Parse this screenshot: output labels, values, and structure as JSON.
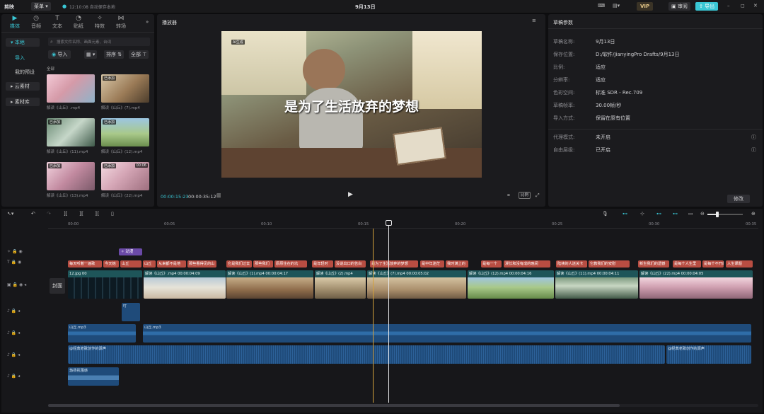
{
  "app": {
    "logo": "剪映",
    "menu": "菜单",
    "autosave": "12:10:08 自动保存本地",
    "project_title": "9月13日",
    "vip": "VIP",
    "review": "审阅",
    "export": "导出"
  },
  "media_panel": {
    "tabs": [
      {
        "label": "媒体",
        "icon": "media-icon"
      },
      {
        "label": "音频",
        "icon": "audio-icon"
      },
      {
        "label": "文本",
        "icon": "text-icon"
      },
      {
        "label": "贴纸",
        "icon": "sticker-icon"
      },
      {
        "label": "特效",
        "icon": "effects-icon"
      },
      {
        "label": "转场",
        "icon": "transition-icon"
      }
    ],
    "sidebar": [
      "本地",
      "导入",
      "我的预设",
      "云素材",
      "素材库"
    ],
    "search_placeholder": "搜索文件名称、画面元素、台词",
    "import_label": "导入",
    "sort_label": "排序",
    "filter_label": "全部",
    "section_label": "全部",
    "items": [
      {
        "name": "解读《山丘》.mp4",
        "badge": ""
      },
      {
        "name": "解读《山丘》(7).mp4",
        "badge": "已添加"
      },
      {
        "name": "解读《山丘》(11).mp4",
        "badge": "已添加"
      },
      {
        "name": "解读《山丘》(12).mp4",
        "badge": "已添加"
      },
      {
        "name": "解读《山丘》(13).mp4",
        "badge": "已添加"
      },
      {
        "name": "解读《山丘》(22).mp4",
        "badge": "已添加",
        "duration": "00:06"
      }
    ]
  },
  "player": {
    "title": "播放器",
    "overlay_tag": "AI生成",
    "subtitle": "是为了生活放弃的梦想",
    "current_time": "00:00:15:23",
    "total_time": "00:00:35:12",
    "ratio_label": "比例"
  },
  "draft": {
    "title": "草稿参数",
    "props": [
      {
        "k": "草稿名称:",
        "v": "9月13日"
      },
      {
        "k": "保存位置:",
        "v": "D:/软件/JianyingPro Drafts/9月13日"
      },
      {
        "k": "比例:",
        "v": "适应"
      },
      {
        "k": "分辨率:",
        "v": "适应"
      },
      {
        "k": "色彩空间:",
        "v": "标准 SDR - Rec.709"
      },
      {
        "k": "草稿帧率:",
        "v": "30.00帧/秒"
      },
      {
        "k": "导入方式:",
        "v": "保留在原有位置"
      }
    ],
    "props2": [
      {
        "k": "代理模式:",
        "v": "未开启"
      },
      {
        "k": "自由层级:",
        "v": "已开启"
      }
    ],
    "modify": "修改"
  },
  "timeline": {
    "ruler": [
      "00:00",
      "00:05",
      "00:10",
      "00:15",
      "00:20",
      "00:25",
      "00:30",
      "00:35"
    ],
    "cover_label": "封面",
    "effect_label": "动漫",
    "subtitles": [
      "每天听着一遍歌",
      "今天她",
      "山丘",
      "山丘",
      "从来都不是地",
      "那些看得见的山",
      "它是我们过去",
      "那些我们",
      "原原住在的坑",
      "是年轻时",
      "没说出口的告白",
      "是为了生活放弃的梦想",
      "是中年迷茫",
      "我时满上的",
      "是每一个",
      "漫长和没有成的晚间",
      "陆续的人迷关卡",
      "它教我们的安慰",
      "新生我们的遗憾",
      "是每个人生里",
      "是每个不开的",
      "人生课题"
    ],
    "clips": [
      {
        "label": "12.jpg 00"
      },
      {
        "label": "解读《山丘》.mp4  00:00:04:09"
      },
      {
        "label": "解读《山丘》(1).mp4  00:00:04:17"
      },
      {
        "label": "解读《山丘》(2).mp4"
      },
      {
        "label": "解读《山丘》(7).mp4  00:00:05:02"
      },
      {
        "label": "解读《山丘》(12).mp4  00:00:04:16"
      },
      {
        "label": "解读《山丘》(11).mp4  00:00:04:11"
      },
      {
        "label": "解读《山丘》(22).mp4  00:00:04:05"
      }
    ],
    "small_clip": "叮",
    "audio1": [
      {
        "label": "山丘.mp3"
      },
      {
        "label": "山丘.mp3"
      }
    ],
    "audio2": [
      {
        "label": "@经典老歌创作的源声"
      },
      {
        "label": "@经典老歌创作的源声"
      }
    ],
    "audio3": [
      {
        "label": "悠扬氛围感"
      }
    ]
  },
  "colors": {
    "accent": "#39c6d4",
    "subtitle_clip": "#b84d42",
    "video_clip": "#2b6a6e",
    "audio_clip": "#1f4b7a"
  }
}
